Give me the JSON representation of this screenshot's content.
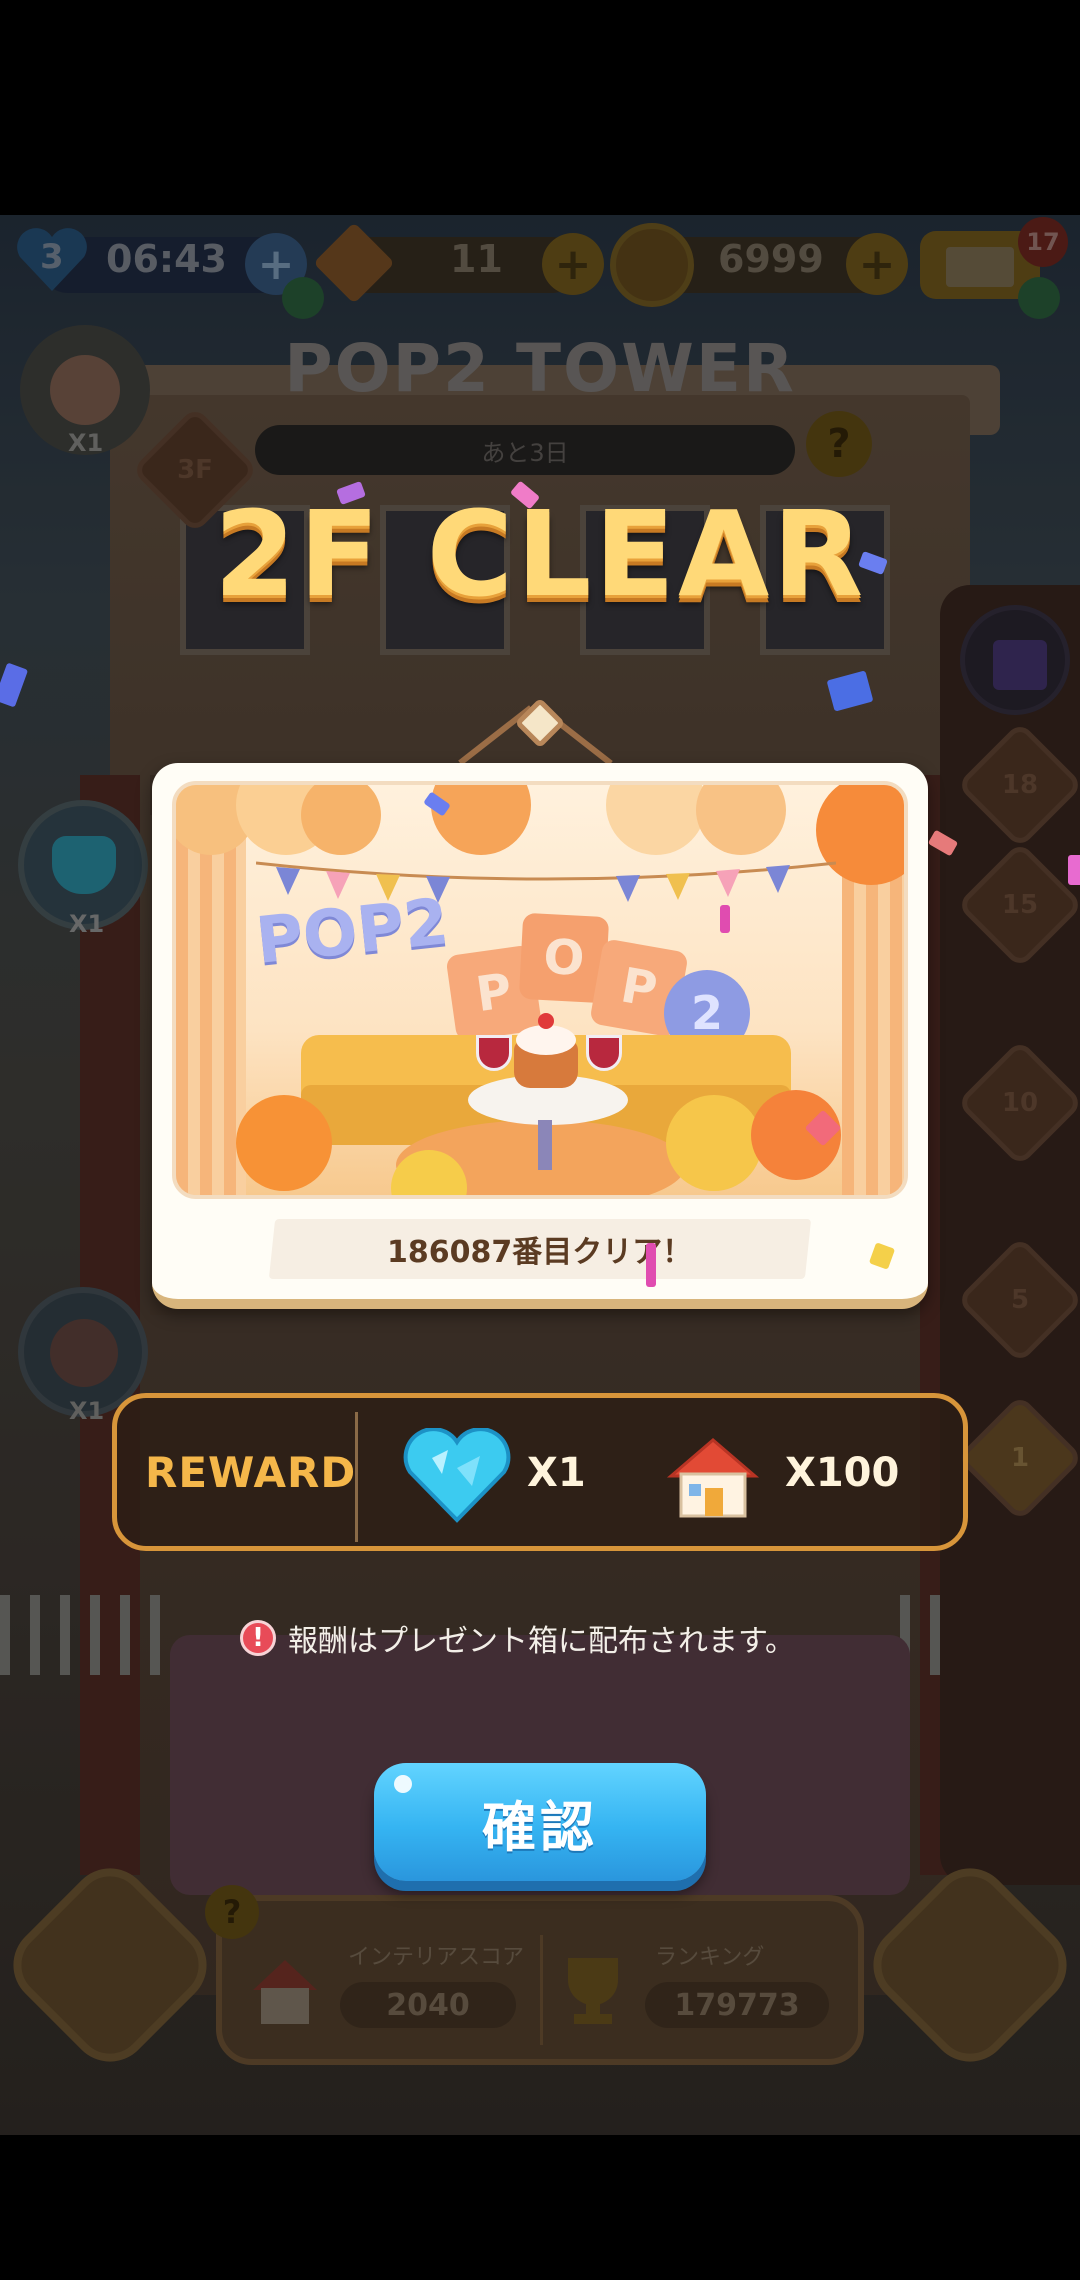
{
  "hud": {
    "hearts_count": "3",
    "timer": "06:43",
    "gems": "11",
    "coins": "6999",
    "mail_badge": "17"
  },
  "tower": {
    "title": "POP2 TOWER",
    "days_left": "あと3日",
    "help": "?",
    "floor_label_top": "3F",
    "floor_labels_right": [
      "18",
      "15",
      "10",
      "5",
      "1"
    ],
    "left_items": [
      {
        "icon": "cake-icon",
        "qty": "X1"
      },
      {
        "icon": "heart-icon",
        "qty": "X1"
      },
      {
        "icon": "clear-badge-icon",
        "qty": "X1"
      }
    ]
  },
  "popup": {
    "title": "2F CLEAR",
    "scene_text": "POP2",
    "cube_letters": [
      "P",
      "O",
      "P"
    ],
    "balloon_text": "2",
    "clear_order": "186087番目クリア！",
    "reward_label": "REWARD",
    "rewards": [
      {
        "icon": "heart-icon",
        "qty": "X1"
      },
      {
        "icon": "house-icon",
        "qty": "X100"
      }
    ],
    "notice": "報酬はプレゼント箱に配布されます。",
    "confirm_label": "確認"
  },
  "bottom": {
    "help": "?",
    "interior_label": "インテリアスコア",
    "interior_value": "2040",
    "ranking_label": "ランキング",
    "ranking_value": "179773"
  },
  "colors": {
    "title_gold": "#ffd978",
    "reward_border": "#d7953a",
    "confirm_blue": "#35b4f2"
  }
}
